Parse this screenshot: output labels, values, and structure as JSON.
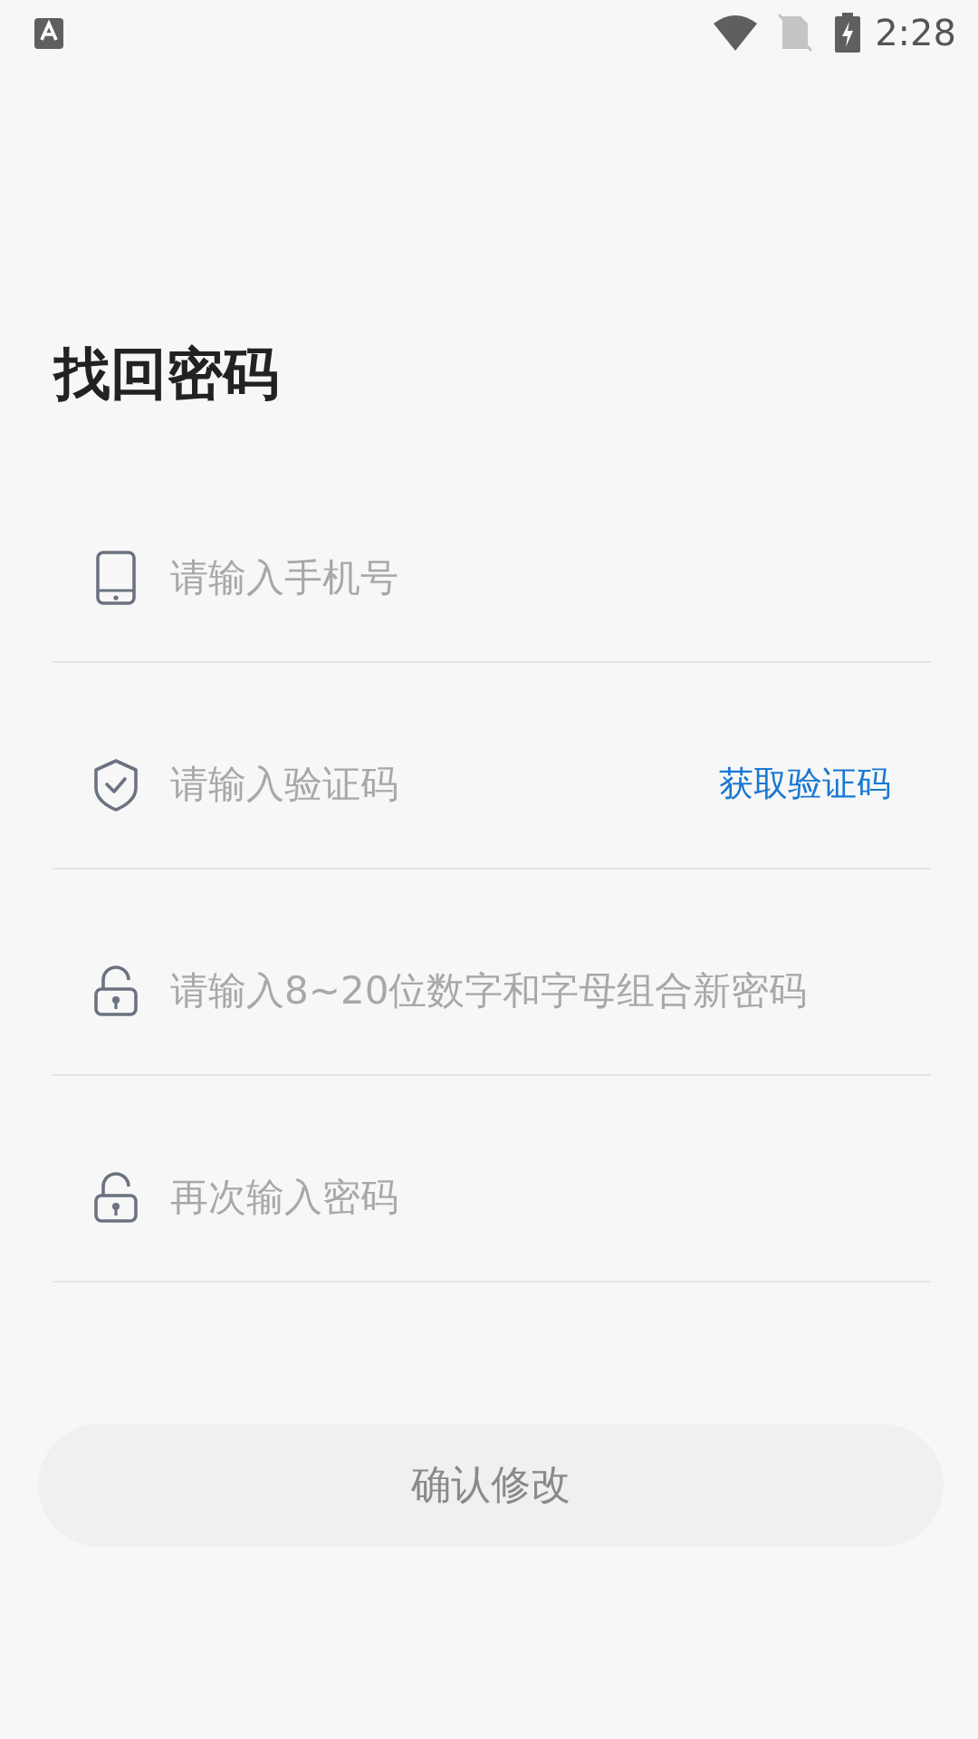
{
  "status_bar": {
    "time": "2:28"
  },
  "title": "找回密码",
  "fields": [
    {
      "kind": "phone",
      "placeholder": "请输入手机号"
    },
    {
      "kind": "code",
      "placeholder": "请输入验证码",
      "action": "获取验证码"
    },
    {
      "kind": "password",
      "placeholder": "请输入8~20位数字和字母组合新密码"
    },
    {
      "kind": "password",
      "placeholder": "再次输入密码"
    }
  ],
  "submit": {
    "label": "确认修改",
    "disabled": true
  }
}
